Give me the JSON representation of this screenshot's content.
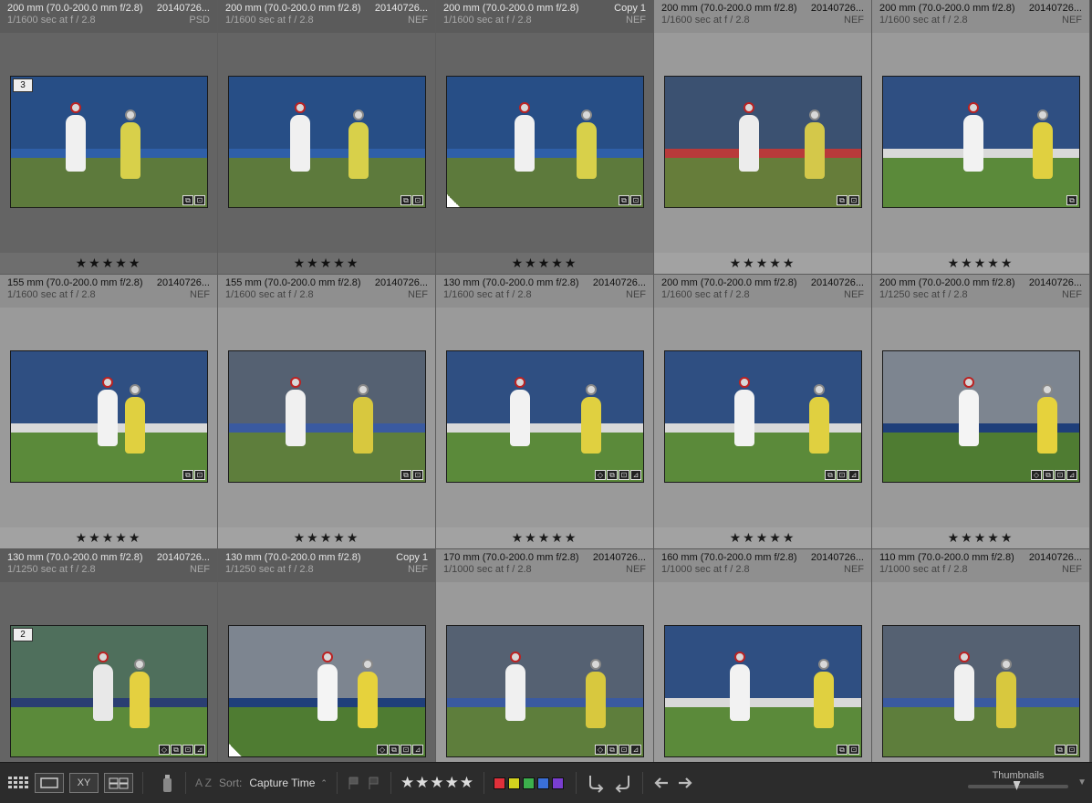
{
  "cells": [
    {
      "r1l": "200 mm (70.0-200.0 mm f/2.8)",
      "r1r": "20140726...",
      "r2l": "1/1600 sec at f / 2.8",
      "r2r": "PSD",
      "stars": "★★★★★",
      "dark": true,
      "stack": "3",
      "badges": [
        "⧉",
        "⊡"
      ],
      "corner": false,
      "scene": "blue"
    },
    {
      "r1l": "200 mm (70.0-200.0 mm f/2.8)",
      "r1r": "20140726...",
      "r2l": "1/1600 sec at f / 2.8",
      "r2r": "NEF",
      "stars": "★★★★★",
      "dark": true,
      "stack": "",
      "badges": [
        "⧉",
        "⊡"
      ],
      "corner": false,
      "scene": "blue"
    },
    {
      "r1l": "200 mm (70.0-200.0 mm f/2.8)",
      "r1r": "Copy 1",
      "r2l": "1/1600 sec at f / 2.8",
      "r2r": "NEF",
      "stars": "★★★★★",
      "dark": true,
      "stack": "",
      "badges": [
        "⧉",
        "⊡"
      ],
      "corner": true,
      "scene": "blue"
    },
    {
      "r1l": "200 mm (70.0-200.0 mm f/2.8)",
      "r1r": "20140726...",
      "r2l": "1/1600 sec at f / 2.8",
      "r2r": "NEF",
      "stars": "★★★★★",
      "dark": false,
      "stack": "",
      "badges": [
        "⧉",
        "⊡"
      ],
      "corner": false,
      "scene": "blur"
    },
    {
      "r1l": "200 mm (70.0-200.0 mm f/2.8)",
      "r1r": "20140726...",
      "r2l": "1/1600 sec at f / 2.8",
      "r2r": "NEF",
      "stars": "★★★★★",
      "dark": false,
      "stack": "",
      "badges": [
        "⧉"
      ],
      "corner": false,
      "scene": "stadium"
    },
    {
      "r1l": "155 mm (70.0-200.0 mm f/2.8)",
      "r1r": "20140726...",
      "r2l": "1/1600 sec at f / 2.8",
      "r2r": "NEF",
      "stars": "★★★★★",
      "dark": false,
      "stack": "",
      "badges": [
        "⧉",
        "⊡"
      ],
      "corner": false,
      "scene": "stadium"
    },
    {
      "r1l": "155 mm (70.0-200.0 mm f/2.8)",
      "r1r": "20140726...",
      "r2l": "1/1600 sec at f / 2.8",
      "r2r": "NEF",
      "stars": "★★★★★",
      "dark": false,
      "stack": "",
      "badges": [
        "⧉",
        "⊡"
      ],
      "corner": false,
      "scene": "crowd"
    },
    {
      "r1l": "130 mm (70.0-200.0 mm f/2.8)",
      "r1r": "20140726...",
      "r2l": "1/1600 sec at f / 2.8",
      "r2r": "NEF",
      "stars": "★★★★★",
      "dark": false,
      "stack": "",
      "badges": [
        "◇",
        "⧉",
        "⊡",
        "⊿"
      ],
      "corner": false,
      "scene": "stadium"
    },
    {
      "r1l": "200 mm (70.0-200.0 mm f/2.8)",
      "r1r": "20140726...",
      "r2l": "1/1600 sec at f / 2.8",
      "r2r": "NEF",
      "stars": "★★★★★",
      "dark": false,
      "stack": "",
      "badges": [
        "⧉",
        "⊡",
        "⊿"
      ],
      "corner": false,
      "scene": "stadium"
    },
    {
      "r1l": "200 mm (70.0-200.0 mm f/2.8)",
      "r1r": "20140726...",
      "r2l": "1/1250 sec at f / 2.8",
      "r2r": "NEF",
      "stars": "★★★★★",
      "dark": false,
      "stack": "",
      "badges": [
        "◇",
        "⧉",
        "⊡",
        "⊿"
      ],
      "corner": false,
      "scene": "goal"
    },
    {
      "r1l": "130 mm (70.0-200.0 mm f/2.8)",
      "r1r": "20140726...",
      "r2l": "1/1250 sec at f / 2.8",
      "r2r": "NEF",
      "stars": "",
      "dark": true,
      "stack": "2",
      "badges": [
        "◇",
        "⧉",
        "⊡",
        "⊿"
      ],
      "corner": false,
      "scene": "trees"
    },
    {
      "r1l": "130 mm (70.0-200.0 mm f/2.8)",
      "r1r": "Copy 1",
      "r2l": "1/1250 sec at f / 2.8",
      "r2r": "NEF",
      "stars": "",
      "dark": true,
      "stack": "",
      "badges": [
        "◇",
        "⧉",
        "⊡",
        "⊿"
      ],
      "corner": true,
      "scene": "goal"
    },
    {
      "r1l": "170 mm (70.0-200.0 mm f/2.8)",
      "r1r": "20140726...",
      "r2l": "1/1000 sec at f / 2.8",
      "r2r": "NEF",
      "stars": "",
      "dark": false,
      "stack": "",
      "badges": [
        "◇",
        "⧉",
        "⊡",
        "⊿"
      ],
      "corner": false,
      "scene": "crowd"
    },
    {
      "r1l": "160 mm (70.0-200.0 mm f/2.8)",
      "r1r": "20140726...",
      "r2l": "1/1000 sec at f / 2.8",
      "r2r": "NEF",
      "stars": "",
      "dark": false,
      "stack": "",
      "badges": [
        "⧉",
        "⊡"
      ],
      "corner": false,
      "scene": "stadium"
    },
    {
      "r1l": "110 mm (70.0-200.0 mm f/2.8)",
      "r1r": "20140726...",
      "r2l": "1/1000 sec at f / 2.8",
      "r2r": "NEF",
      "stars": "",
      "dark": false,
      "stack": "",
      "badges": [
        "⧉",
        "⊡"
      ],
      "corner": false,
      "scene": "crowd"
    }
  ],
  "toolbar": {
    "grid_icon": "grid-view-icon",
    "loupe_icon": "loupe-view-icon",
    "compare_label": "XY",
    "survey_icon": "survey-view-icon",
    "spray_icon": "spray-can-icon",
    "sort_icon_label": "A Z",
    "sort_label": "Sort:",
    "sort_value": "Capture Time",
    "sort_caret": "⌃",
    "stars": "★★★★★",
    "colors": [
      "#e0303a",
      "#d4d21e",
      "#3cb04c",
      "#3a6fd8",
      "#7a3ed0"
    ],
    "thumbnails_label": "Thumbnails",
    "thumbnail_size": 0.45
  }
}
